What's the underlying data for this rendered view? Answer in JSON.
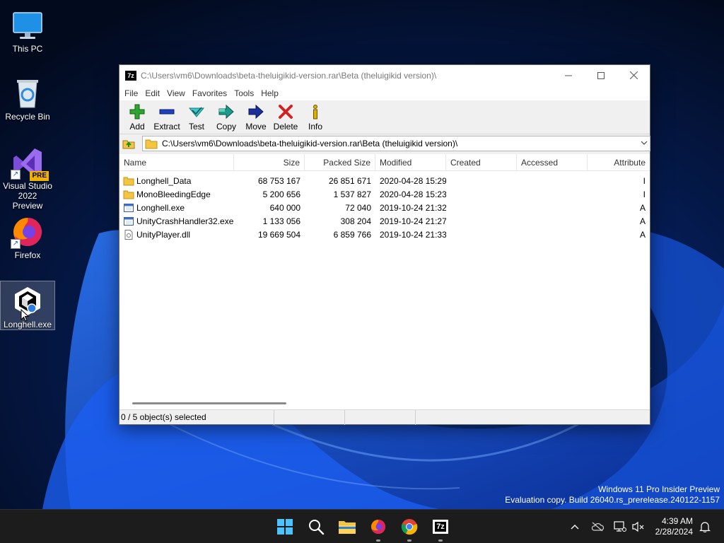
{
  "desktop": {
    "icons": [
      {
        "label": "This PC"
      },
      {
        "label": "Recycle Bin"
      },
      {
        "label": "Visual Studio 2022 Preview",
        "badge": "PRE"
      },
      {
        "label": "Firefox"
      },
      {
        "label": "Longhell.exe"
      }
    ]
  },
  "window": {
    "app_icon_text": "7z",
    "title": "C:\\Users\\vm6\\Downloads\\beta-theluigikid-version.rar\\Beta (theluigikid version)\\",
    "menu": [
      "File",
      "Edit",
      "View",
      "Favorites",
      "Tools",
      "Help"
    ],
    "toolbar": {
      "add": "Add",
      "extract": "Extract",
      "test": "Test",
      "copy": "Copy",
      "move": "Move",
      "delete": "Delete",
      "info": "Info"
    },
    "path": "C:\\Users\\vm6\\Downloads\\beta-theluigikid-version.rar\\Beta (theluigikid version)\\",
    "columns": {
      "name": "Name",
      "size": "Size",
      "packed": "Packed Size",
      "modified": "Modified",
      "created": "Created",
      "accessed": "Accessed",
      "attributes": "Attribute"
    },
    "files": [
      {
        "name": "Longhell_Data",
        "type": "folder",
        "size": "68 753 167",
        "packed": "26 851 671",
        "modified": "2020-04-28 15:29",
        "created": "",
        "accessed": "",
        "attr": "I"
      },
      {
        "name": "MonoBleedingEdge",
        "type": "folder",
        "size": "5 200 656",
        "packed": "1 537 827",
        "modified": "2020-04-28 15:23",
        "created": "",
        "accessed": "",
        "attr": "I"
      },
      {
        "name": "Longhell.exe",
        "type": "exe",
        "size": "640 000",
        "packed": "72 040",
        "modified": "2019-10-24 21:32",
        "created": "",
        "accessed": "",
        "attr": "A"
      },
      {
        "name": "UnityCrashHandler32.exe",
        "type": "exe",
        "size": "1 133 056",
        "packed": "308 204",
        "modified": "2019-10-24 21:27",
        "created": "",
        "accessed": "",
        "attr": "A"
      },
      {
        "name": "UnityPlayer.dll",
        "type": "dll",
        "size": "19 669 504",
        "packed": "6 859 766",
        "modified": "2019-10-24 21:33",
        "created": "",
        "accessed": "",
        "attr": "A"
      }
    ],
    "status": {
      "selection": "0 / 5 object(s) selected",
      "seg2": "",
      "seg3": "",
      "seg4": ""
    }
  },
  "watermark": {
    "line1": "Windows 11 Pro Insider Preview",
    "line2": "Evaluation copy. Build 26040.rs_prerelease.240122-1157"
  },
  "taskbar": {
    "apps": [
      "start-icon",
      "search-icon",
      "file-explorer-icon",
      "firefox-icon",
      "chrome-icon",
      "7zip-icon"
    ],
    "sevenzip_label": "7z",
    "time": "4:39 AM",
    "date": "2/28/2024"
  },
  "colors": {
    "accent_blue": "#1a5fc8",
    "folder_yellow": "#f4c542",
    "add_green": "#2fa52f",
    "delete_red": "#d32020"
  }
}
